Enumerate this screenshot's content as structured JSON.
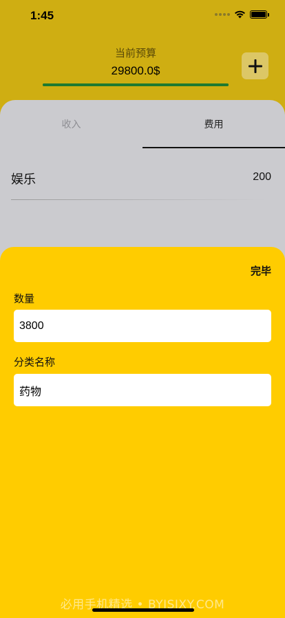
{
  "status_bar": {
    "time": "1:45",
    "icons": [
      "signal-icon",
      "wifi-icon",
      "battery-icon"
    ]
  },
  "header": {
    "budget_title": "当前预算",
    "budget_value": "29800.0$",
    "budget_progress": 1.0,
    "add_button_icon": "plus-icon"
  },
  "tabs": [
    {
      "label": "收入",
      "selected": false
    },
    {
      "label": "费用",
      "selected": true
    }
  ],
  "expense_list": [
    {
      "name": "娱乐",
      "amount": "200"
    }
  ],
  "sheet": {
    "done_label": "完毕",
    "quantity_label": "数量",
    "quantity_value": "3800",
    "category_label": "分类名称",
    "category_value": "药物"
  },
  "watermark": "必用手机精选 • BYJSJXY.COM",
  "colors": {
    "header_bg": "#cfae12",
    "sheet_bg": "#ffcc00",
    "card_bg": "#cbcbcf",
    "progress": "#2e8b3c"
  }
}
